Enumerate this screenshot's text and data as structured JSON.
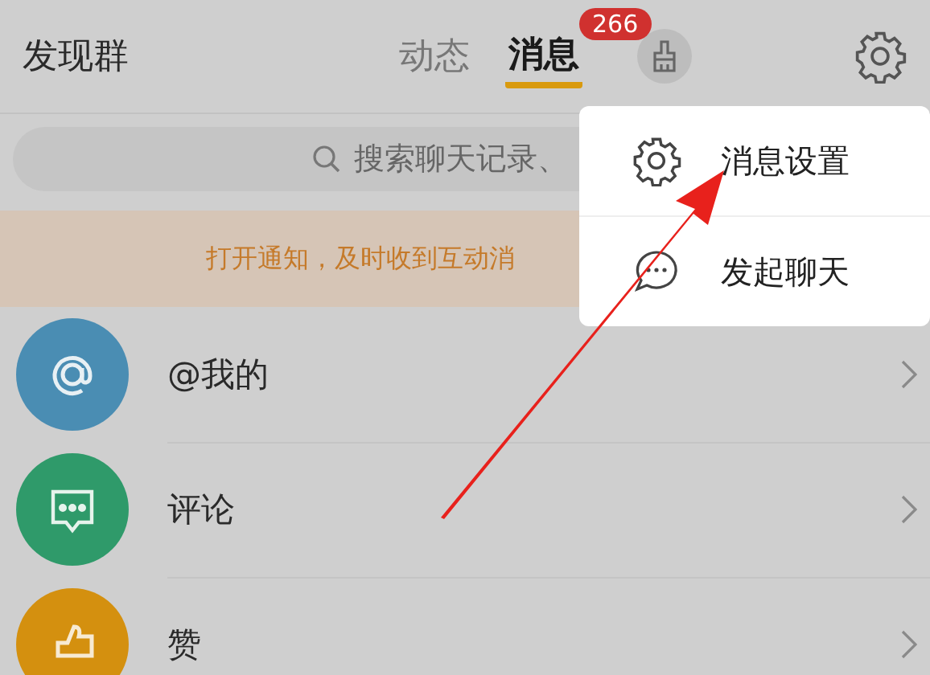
{
  "header": {
    "title": "发现群",
    "tabs": [
      {
        "label": "动态",
        "selected": false
      },
      {
        "label": "消息",
        "selected": true,
        "badge": "266"
      }
    ]
  },
  "search": {
    "placeholder": "搜索聊天记录、"
  },
  "notice": "打开通知，及时收到互动消",
  "items": [
    {
      "kind": "mention",
      "label": "@我的"
    },
    {
      "kind": "comment",
      "label": "评论"
    },
    {
      "kind": "like",
      "label": "赞"
    }
  ],
  "menu": [
    {
      "kind": "settings",
      "label": "消息设置"
    },
    {
      "kind": "chat",
      "label": "发起聊天"
    }
  ]
}
